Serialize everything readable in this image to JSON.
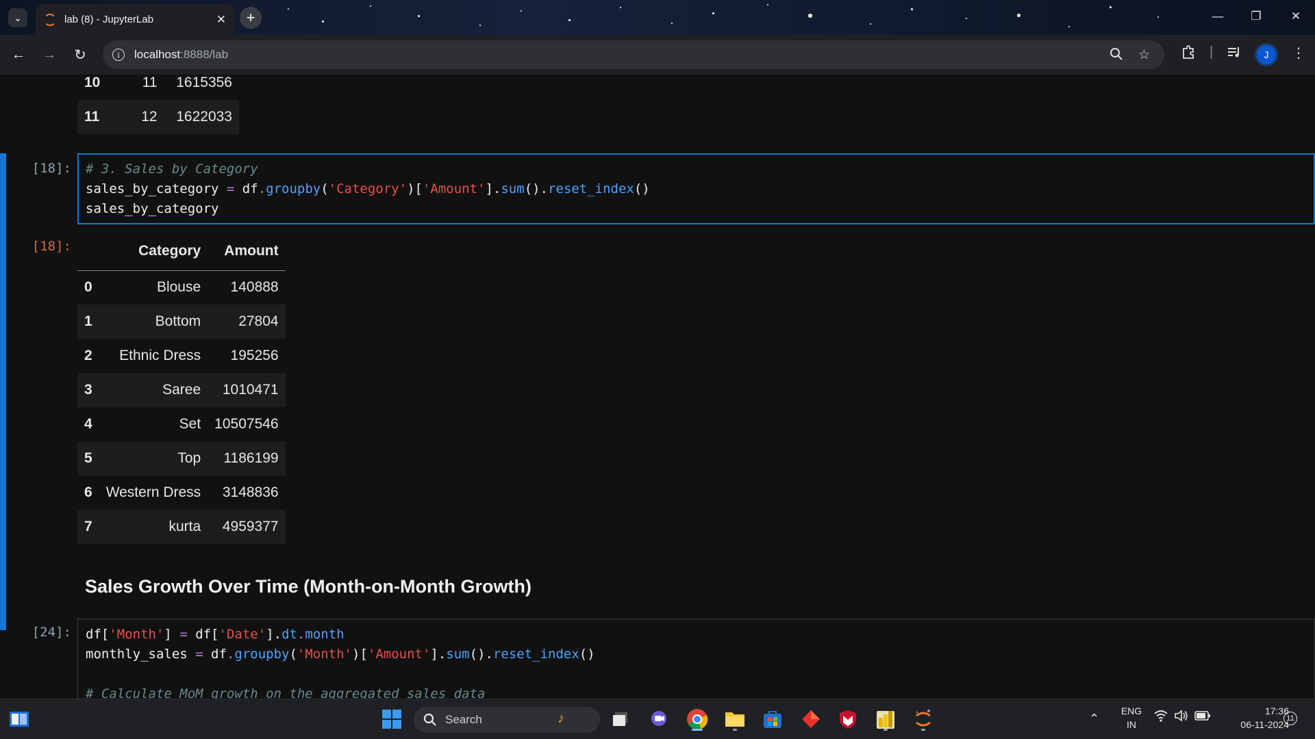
{
  "browser": {
    "tab_title": "lab (8) - JupyterLab",
    "url_host": "localhost",
    "url_path": ":8888/lab",
    "profile_initial": "J"
  },
  "notebook": {
    "prev_table": {
      "rows": [
        {
          "index": "10",
          "month": "11",
          "amount": "1615356"
        },
        {
          "index": "11",
          "month": "12",
          "amount": "1622033"
        }
      ]
    },
    "cell18": {
      "prompt_in": "[18]:",
      "prompt_out": "[18]:",
      "comment": "# 3. Sales by Category",
      "line2": {
        "var": "sales_by_category",
        "op": " = ",
        "obj": "df",
        "dot1": ".",
        "groupby": "groupby",
        "paren_open": "(",
        "key": "'Category'",
        "mid": ")[",
        "col": "'Amount'",
        "close": "].",
        "sum": "sum",
        "mid2": "().",
        "reset": "reset_index",
        "end": "()"
      },
      "line3": "sales_by_category"
    },
    "sales_table": {
      "headers": [
        "",
        "Category",
        "Amount"
      ],
      "rows": [
        {
          "index": "0",
          "category": "Blouse",
          "amount": "140888"
        },
        {
          "index": "1",
          "category": "Bottom",
          "amount": "27804"
        },
        {
          "index": "2",
          "category": "Ethnic Dress",
          "amount": "195256"
        },
        {
          "index": "3",
          "category": "Saree",
          "amount": "1010471"
        },
        {
          "index": "4",
          "category": "Set",
          "amount": "10507546"
        },
        {
          "index": "5",
          "category": "Top",
          "amount": "1186199"
        },
        {
          "index": "6",
          "category": "Western Dress",
          "amount": "3148836"
        },
        {
          "index": "7",
          "category": "kurta",
          "amount": "4959377"
        }
      ]
    },
    "heading": "Sales Growth Over Time (Month-on-Month Growth)",
    "cell24": {
      "prompt_in": "[24]:",
      "l1": {
        "a": "df",
        "b": "[",
        "c": "'Month'",
        "d": "]",
        "e": " = ",
        "f": "df",
        "g": "[",
        "h": "'Date'",
        "i": "].",
        "j": "dt",
        "k": ".",
        "l": "month"
      },
      "l2": {
        "a": "monthly_sales",
        "b": " = ",
        "c": "df",
        "d": ".",
        "e": "groupby",
        "f": "(",
        "g": "'Month'",
        "h": ")[",
        "i": "'Amount'",
        "j": "].",
        "k": "sum",
        "l": "().",
        "m": "reset_index",
        "n": "()"
      },
      "l4": "# Calculate MoM growth on the aggregated sales data"
    }
  },
  "taskbar": {
    "search_label": "Search",
    "lang_top": "ENG",
    "lang_bottom": "IN",
    "time": "17:36",
    "date": "06-11-2024",
    "notification_count": "11"
  },
  "colors": {
    "accent": "#1976d2",
    "out_prompt": "#d26a4a",
    "string": "#e4514b",
    "function": "#4da3ff",
    "operator": "#b37ed8"
  }
}
